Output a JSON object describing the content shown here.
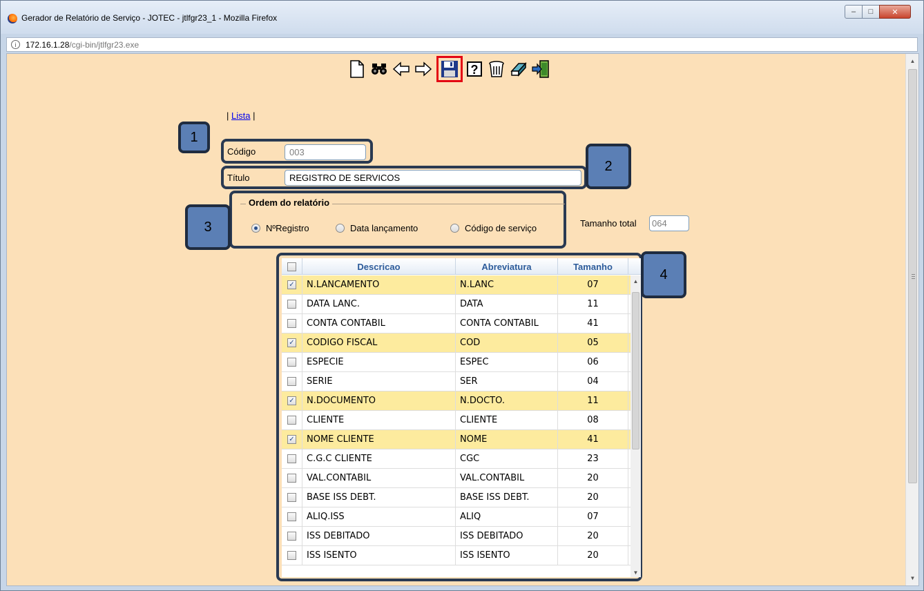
{
  "window": {
    "title": "Gerador de Relatório de Serviço - JOTEC - jtlfgr23_1 - Mozilla Firefox",
    "controls": {
      "minimize": "–",
      "maximize": "□",
      "close": "✕"
    }
  },
  "address": {
    "host": "172.16.1.28",
    "path": "/cgi-bin/jtlfgr23.exe"
  },
  "toolbar": {
    "icons": [
      "new-document-icon",
      "search-binoculars-icon",
      "previous-arrow-icon",
      "next-arrow-icon",
      "save-floppy-icon",
      "help-icon",
      "delete-trash-icon",
      "eraser-icon",
      "exit-icon"
    ],
    "highlight_color": "#e30613"
  },
  "nav": {
    "sep_left": "| ",
    "lista_link": "Lista",
    "sep_right": " |"
  },
  "form": {
    "codigo_label": "Código",
    "codigo_value": "003",
    "titulo_label": "Título",
    "titulo_value": "REGISTRO DE SERVICOS",
    "ordem_legend": "Ordem do relatório",
    "ordem_options": [
      {
        "label": "NºRegistro",
        "selected": true
      },
      {
        "label": "Data lançamento",
        "selected": false
      },
      {
        "label": "Código de serviço",
        "selected": false
      }
    ],
    "tamanho_label": "Tamanho total",
    "tamanho_value": "064"
  },
  "callouts": {
    "badge1": "1",
    "badge2": "2",
    "badge3": "3",
    "badge4": "4"
  },
  "table": {
    "headers": {
      "descricao": "Descricao",
      "abreviatura": "Abreviatura",
      "tamanho": "Tamanho"
    },
    "rows": [
      {
        "checked": true,
        "descricao": "N.LANCAMENTO",
        "abreviatura": "N.LANC",
        "tamanho": "07"
      },
      {
        "checked": false,
        "descricao": "DATA LANC.",
        "abreviatura": "DATA",
        "tamanho": "11"
      },
      {
        "checked": false,
        "descricao": "CONTA CONTABIL",
        "abreviatura": "CONTA CONTABIL",
        "tamanho": "41"
      },
      {
        "checked": true,
        "descricao": "CODIGO FISCAL",
        "abreviatura": "COD",
        "tamanho": "05"
      },
      {
        "checked": false,
        "descricao": "ESPECIE",
        "abreviatura": "ESPEC",
        "tamanho": "06"
      },
      {
        "checked": false,
        "descricao": "SERIE",
        "abreviatura": "SER",
        "tamanho": "04"
      },
      {
        "checked": true,
        "descricao": "N.DOCUMENTO",
        "abreviatura": "N.DOCTO.",
        "tamanho": "11"
      },
      {
        "checked": false,
        "descricao": "CLIENTE",
        "abreviatura": "CLIENTE",
        "tamanho": "08"
      },
      {
        "checked": true,
        "descricao": "NOME CLIENTE",
        "abreviatura": "NOME",
        "tamanho": "41"
      },
      {
        "checked": false,
        "descricao": "C.G.C CLIENTE",
        "abreviatura": "CGC",
        "tamanho": "23"
      },
      {
        "checked": false,
        "descricao": "VAL.CONTABIL",
        "abreviatura": "VAL.CONTABIL",
        "tamanho": "20"
      },
      {
        "checked": false,
        "descricao": "BASE ISS DEBT.",
        "abreviatura": "BASE ISS DEBT.",
        "tamanho": "20"
      },
      {
        "checked": false,
        "descricao": "ALIQ.ISS",
        "abreviatura": "ALIQ",
        "tamanho": "07"
      },
      {
        "checked": false,
        "descricao": "ISS DEBITADO",
        "abreviatura": "ISS DEBITADO",
        "tamanho": "20"
      },
      {
        "checked": false,
        "descricao": "ISS ISENTO",
        "abreviatura": "ISS ISENTO",
        "tamanho": "20"
      }
    ]
  },
  "colors": {
    "page_bg": "#fce0b8",
    "selected_row": "#fdeb9e",
    "header_text": "#2c5b9a",
    "badge_fill": "#5b7fb5",
    "callout_border": "#2a3a52"
  }
}
